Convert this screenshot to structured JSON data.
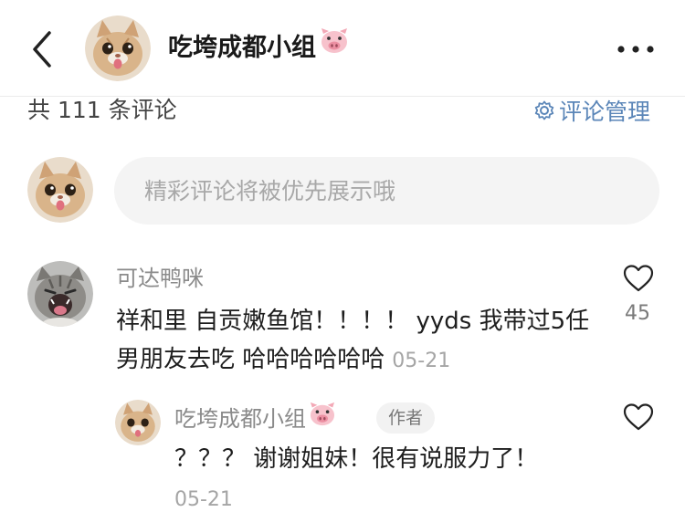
{
  "header": {
    "title": "吃垮成都小组",
    "title_emoji": "pig-face"
  },
  "comments_bar": {
    "count_text": "共 111 条评论",
    "manage_label": "评论管理"
  },
  "input": {
    "placeholder": "精彩评论将被优先展示哦"
  },
  "comments": [
    {
      "author": "可达鸭咪",
      "text": "祥和里 自贡嫩鱼馆！！！！ yyds 我带过5任男朋友去吃 哈哈哈哈哈哈",
      "date": "05-21",
      "likes": "45",
      "replies": [
        {
          "author": "吃垮成都小组",
          "author_emoji": "pig-face",
          "badge": "作者",
          "text": "？？？ 谢谢姐妹！很有说服力了！",
          "date": "05-21"
        }
      ]
    }
  ],
  "colors": {
    "link_blue": "#5b86b8",
    "input_bg": "#f4f4f4",
    "muted_text": "#8a8a8a"
  }
}
